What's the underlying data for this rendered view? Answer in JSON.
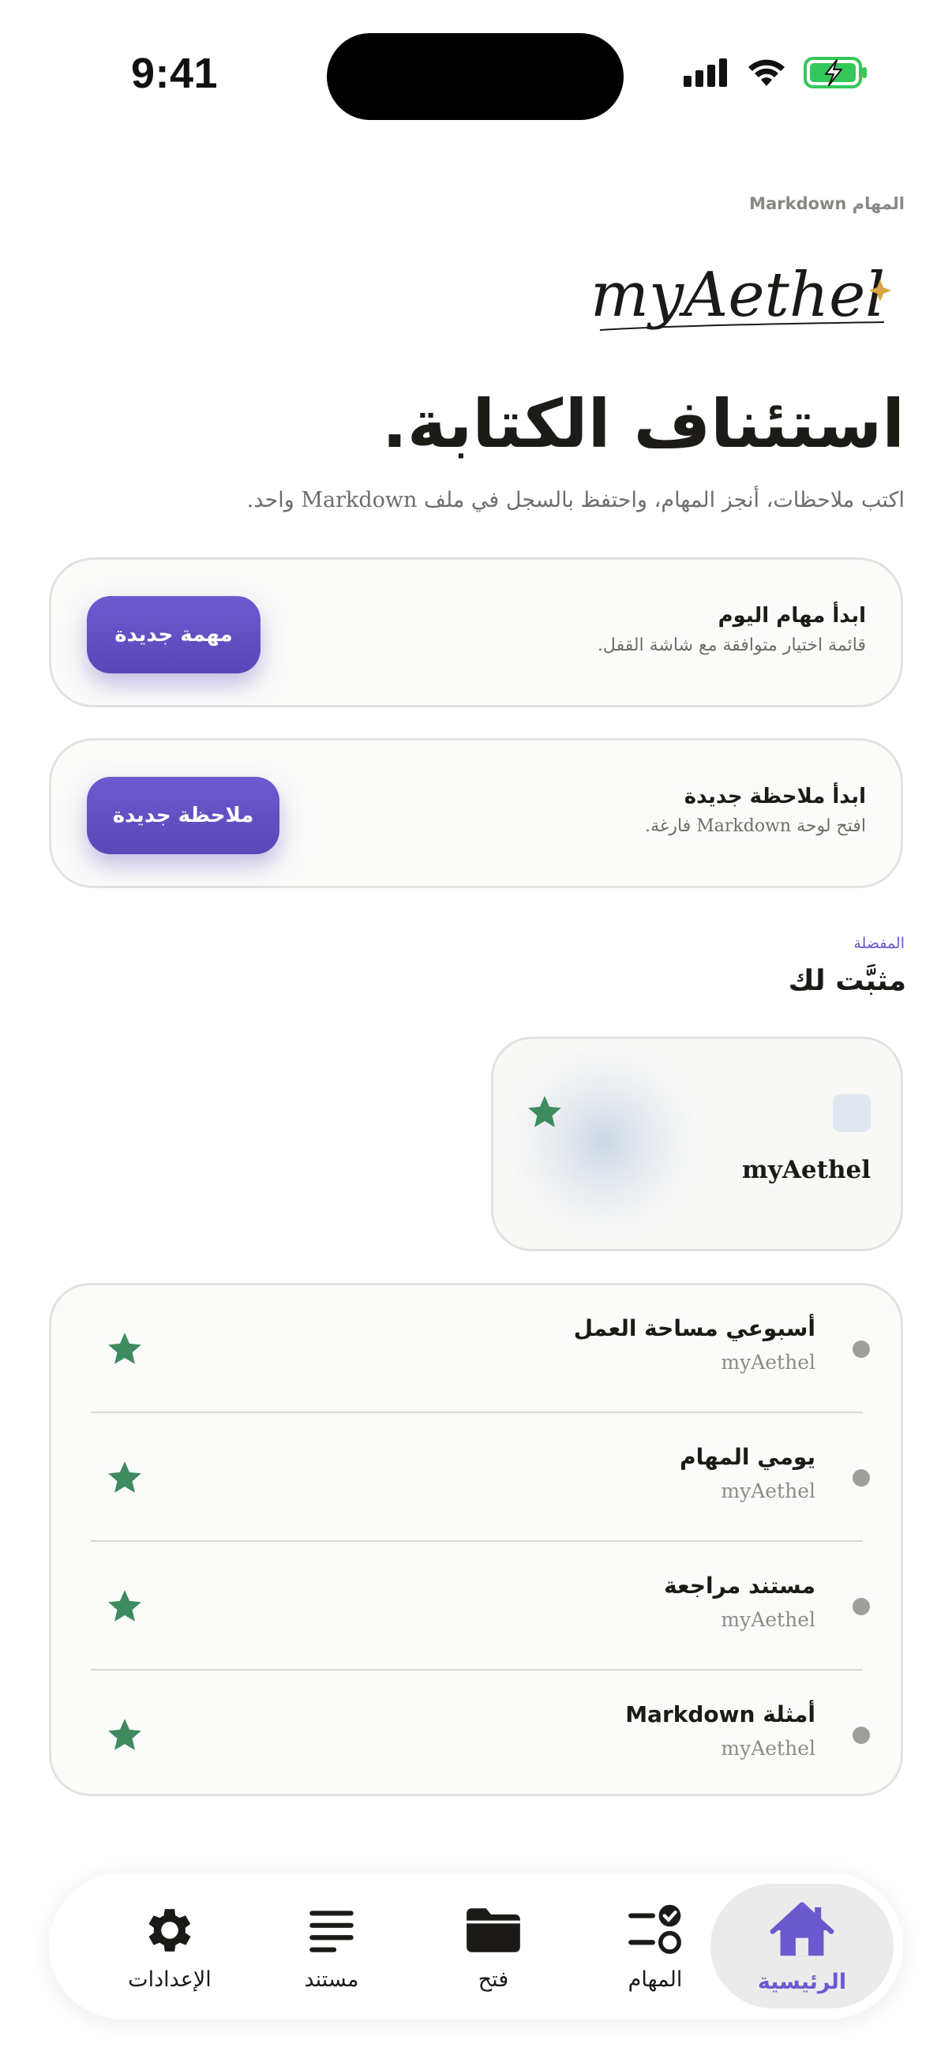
{
  "status_bar": {
    "time": "9:41"
  },
  "header": {
    "subhead": "المهام Markdown",
    "logo_text": "myAethel",
    "title": "استئناف الكتابة.",
    "subtitle": "اكتب ملاحظات، أنجز المهام، واحتفظ بالسجل في ملف Markdown واحد."
  },
  "actions": [
    {
      "title": "ابدأ مهام اليوم",
      "description": "قائمة اختيار متوافقة مع شاشة القفل.",
      "button": "مهمة جديدة"
    },
    {
      "title": "ابدأ ملاحظة جديدة",
      "description": "افتح لوحة Markdown فارغة.",
      "button": "ملاحظة جديدة"
    }
  ],
  "favorites": {
    "eyebrow": "المفضلة",
    "title": "مثبَّت لك",
    "pinned_name": "myAethel",
    "items": [
      {
        "title": "أسبوعي مساحة العمل",
        "subtitle": "myAethel"
      },
      {
        "title": "يومي المهام",
        "subtitle": "myAethel"
      },
      {
        "title": "مستند مراجعة",
        "subtitle": "myAethel"
      },
      {
        "title": "أمثلة Markdown",
        "subtitle": "myAethel"
      }
    ]
  },
  "tabs": [
    {
      "label": "الإعدادات",
      "icon": "gear-icon"
    },
    {
      "label": "مستند",
      "icon": "document-lines-icon"
    },
    {
      "label": "فتح",
      "icon": "folder-icon"
    },
    {
      "label": "المهام",
      "icon": "tasks-icon"
    },
    {
      "label": "الرئيسية",
      "icon": "home-icon",
      "active": true
    }
  ],
  "colors": {
    "accent": "#6a5acd",
    "star": "#3d8b5e",
    "battery": "#34c759"
  }
}
